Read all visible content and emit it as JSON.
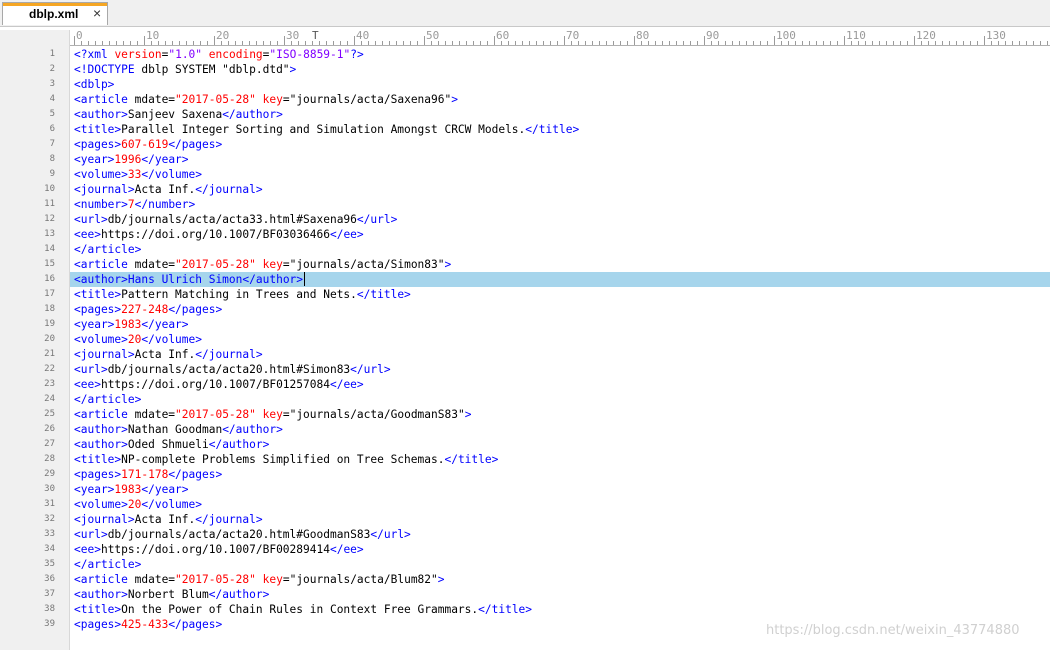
{
  "tab": {
    "title": "dblp.xml",
    "close": "×"
  },
  "ruler": {
    "labels": [
      "0",
      "10",
      "20",
      "30",
      "40",
      "50",
      "60",
      "70",
      "80",
      "90",
      "100",
      "110",
      "120",
      "130"
    ],
    "caret": "T"
  },
  "colors": {
    "tag": "#0000ff",
    "attr": "#ff0000",
    "value": "#8000ff",
    "text": "#000000",
    "current_line": "#a6d5ec"
  },
  "editor": {
    "current_line": 16,
    "lines": [
      [
        [
          "tag",
          "<?"
        ],
        [
          "tag",
          "xml "
        ],
        [
          "attr",
          "version"
        ],
        [
          "text",
          "="
        ],
        [
          "value",
          "\"1.0\""
        ],
        [
          "text",
          " "
        ],
        [
          "attr",
          "encoding"
        ],
        [
          "text",
          "="
        ],
        [
          "value",
          "\"ISO-8859-1\""
        ],
        [
          "tag",
          "?>"
        ]
      ],
      [
        [
          "tag",
          "<!DOCTYPE "
        ],
        [
          "text",
          "dblp SYSTEM \"dblp.dtd\""
        ],
        [
          "tag",
          ">"
        ]
      ],
      [
        [
          "tag",
          "<dblp>"
        ]
      ],
      [
        [
          "tag",
          "<article "
        ],
        [
          "text",
          "mdate="
        ],
        [
          "attr",
          "\"2017-05-28\""
        ],
        [
          "text",
          " "
        ],
        [
          "attr",
          "key"
        ],
        [
          "text",
          "=\"journals/acta/Saxena96\""
        ],
        [
          "tag",
          ">"
        ]
      ],
      [
        [
          "tag",
          "<author>"
        ],
        [
          "text",
          "Sanjeev Saxena"
        ],
        [
          "tag",
          "</author>"
        ]
      ],
      [
        [
          "tag",
          "<title>"
        ],
        [
          "text",
          "Parallel Integer Sorting and Simulation Amongst CRCW Models."
        ],
        [
          "tag",
          "</title>"
        ]
      ],
      [
        [
          "tag",
          "<pages>"
        ],
        [
          "attr",
          "607-619"
        ],
        [
          "tag",
          "</pages>"
        ]
      ],
      [
        [
          "tag",
          "<year>"
        ],
        [
          "attr",
          "1996"
        ],
        [
          "tag",
          "</year>"
        ]
      ],
      [
        [
          "tag",
          "<volume>"
        ],
        [
          "attr",
          "33"
        ],
        [
          "tag",
          "</volume>"
        ]
      ],
      [
        [
          "tag",
          "<journal>"
        ],
        [
          "text",
          "Acta Inf."
        ],
        [
          "tag",
          "</journal>"
        ]
      ],
      [
        [
          "tag",
          "<number>"
        ],
        [
          "attr",
          "7"
        ],
        [
          "tag",
          "</number>"
        ]
      ],
      [
        [
          "tag",
          "<url>"
        ],
        [
          "text",
          "db/journals/acta/acta33.html#Saxena96"
        ],
        [
          "tag",
          "</url>"
        ]
      ],
      [
        [
          "tag",
          "<ee>"
        ],
        [
          "text",
          "https://doi.org/10.1007/BF03036466"
        ],
        [
          "tag",
          "</ee>"
        ]
      ],
      [
        [
          "tag",
          "</article>"
        ]
      ],
      [
        [
          "tag",
          "<article "
        ],
        [
          "text",
          "mdate="
        ],
        [
          "attr",
          "\"2017-05-28\""
        ],
        [
          "text",
          " "
        ],
        [
          "attr",
          "key"
        ],
        [
          "text",
          "=\"journals/acta/Simon83\""
        ],
        [
          "tag",
          ">"
        ]
      ],
      [
        [
          "tag",
          "<author>"
        ],
        [
          "tag",
          "Hans Ulrich Simon"
        ],
        [
          "tag",
          "</author>"
        ]
      ],
      [
        [
          "tag",
          "<title>"
        ],
        [
          "text",
          "Pattern Matching in Trees and Nets."
        ],
        [
          "tag",
          "</title>"
        ]
      ],
      [
        [
          "tag",
          "<pages>"
        ],
        [
          "attr",
          "227-248"
        ],
        [
          "tag",
          "</pages>"
        ]
      ],
      [
        [
          "tag",
          "<year>"
        ],
        [
          "attr",
          "1983"
        ],
        [
          "tag",
          "</year>"
        ]
      ],
      [
        [
          "tag",
          "<volume>"
        ],
        [
          "attr",
          "20"
        ],
        [
          "tag",
          "</volume>"
        ]
      ],
      [
        [
          "tag",
          "<journal>"
        ],
        [
          "text",
          "Acta Inf."
        ],
        [
          "tag",
          "</journal>"
        ]
      ],
      [
        [
          "tag",
          "<url>"
        ],
        [
          "text",
          "db/journals/acta/acta20.html#Simon83"
        ],
        [
          "tag",
          "</url>"
        ]
      ],
      [
        [
          "tag",
          "<ee>"
        ],
        [
          "text",
          "https://doi.org/10.1007/BF01257084"
        ],
        [
          "tag",
          "</ee>"
        ]
      ],
      [
        [
          "tag",
          "</article>"
        ]
      ],
      [
        [
          "tag",
          "<article "
        ],
        [
          "text",
          "mdate="
        ],
        [
          "attr",
          "\"2017-05-28\""
        ],
        [
          "text",
          " "
        ],
        [
          "attr",
          "key"
        ],
        [
          "text",
          "=\"journals/acta/GoodmanS83\""
        ],
        [
          "tag",
          ">"
        ]
      ],
      [
        [
          "tag",
          "<author>"
        ],
        [
          "text",
          "Nathan Goodman"
        ],
        [
          "tag",
          "</author>"
        ]
      ],
      [
        [
          "tag",
          "<author>"
        ],
        [
          "text",
          "Oded Shmueli"
        ],
        [
          "tag",
          "</author>"
        ]
      ],
      [
        [
          "tag",
          "<title>"
        ],
        [
          "text",
          "NP-complete Problems Simplified on Tree Schemas."
        ],
        [
          "tag",
          "</title>"
        ]
      ],
      [
        [
          "tag",
          "<pages>"
        ],
        [
          "attr",
          "171-178"
        ],
        [
          "tag",
          "</pages>"
        ]
      ],
      [
        [
          "tag",
          "<year>"
        ],
        [
          "attr",
          "1983"
        ],
        [
          "tag",
          "</year>"
        ]
      ],
      [
        [
          "tag",
          "<volume>"
        ],
        [
          "attr",
          "20"
        ],
        [
          "tag",
          "</volume>"
        ]
      ],
      [
        [
          "tag",
          "<journal>"
        ],
        [
          "text",
          "Acta Inf."
        ],
        [
          "tag",
          "</journal>"
        ]
      ],
      [
        [
          "tag",
          "<url>"
        ],
        [
          "text",
          "db/journals/acta/acta20.html#GoodmanS83"
        ],
        [
          "tag",
          "</url>"
        ]
      ],
      [
        [
          "tag",
          "<ee>"
        ],
        [
          "text",
          "https://doi.org/10.1007/BF00289414"
        ],
        [
          "tag",
          "</ee>"
        ]
      ],
      [
        [
          "tag",
          "</article>"
        ]
      ],
      [
        [
          "tag",
          "<article "
        ],
        [
          "text",
          "mdate="
        ],
        [
          "attr",
          "\"2017-05-28\""
        ],
        [
          "text",
          " "
        ],
        [
          "attr",
          "key"
        ],
        [
          "text",
          "=\"journals/acta/Blum82\""
        ],
        [
          "tag",
          ">"
        ]
      ],
      [
        [
          "tag",
          "<author>"
        ],
        [
          "text",
          "Norbert Blum"
        ],
        [
          "tag",
          "</author>"
        ]
      ],
      [
        [
          "tag",
          "<title>"
        ],
        [
          "text",
          "On the Power of Chain Rules in Context Free Grammars."
        ],
        [
          "tag",
          "</title>"
        ]
      ],
      [
        [
          "tag",
          "<pages>"
        ],
        [
          "attr",
          "425-433"
        ],
        [
          "tag",
          "</pages>"
        ]
      ]
    ]
  },
  "watermark": "https://blog.csdn.net/weixin_43774880"
}
